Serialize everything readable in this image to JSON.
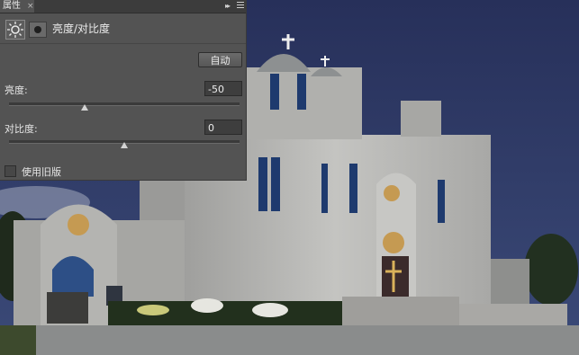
{
  "panel": {
    "tab_label": "属性",
    "tab_close": "×",
    "collapse_glyph": "▸▸",
    "header_icon": "sun-adjustment-icon",
    "mask_icon": "layer-mask-icon",
    "title": "亮度/对比度",
    "auto_button": "自动",
    "brightness": {
      "label": "亮度:",
      "value": "-50",
      "slider_fraction": 0.33
    },
    "contrast": {
      "label": "对比度:",
      "value": "0",
      "slider_fraction": 0.5
    },
    "legacy_checkbox": {
      "label": "使用旧版",
      "checked": false
    }
  },
  "photo": {
    "sky_color": "#2a3557",
    "building_color": "#b9b9b6",
    "window_color": "#1e3a6e"
  }
}
